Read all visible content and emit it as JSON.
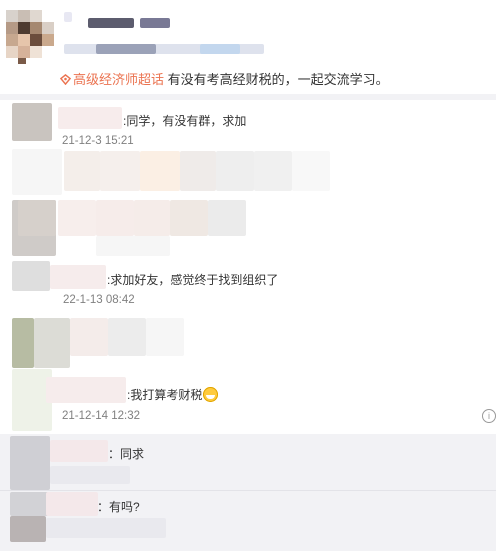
{
  "post": {
    "topic_label": "高级经济师超话",
    "text": " 有没有考高经财税的，一起交流学习。"
  },
  "comments": [
    {
      "text": ":同学，有没有群，求加",
      "time": "21-12-3 15:21"
    },
    {
      "text": ":求加好友，感觉终于找到组织了",
      "time": "22-1-13 08:42"
    },
    {
      "text": ":我打算考财税",
      "emoji": "grin-emoji",
      "time": "21-12-14 12:32"
    }
  ],
  "replies": [
    {
      "text": "：同求"
    },
    {
      "text": "：有吗?"
    }
  ],
  "icons": {
    "info": "info-icon"
  },
  "colors": {
    "topic": "#eb7350",
    "reply_bg": "#f2f2f5",
    "time": "#808080"
  }
}
